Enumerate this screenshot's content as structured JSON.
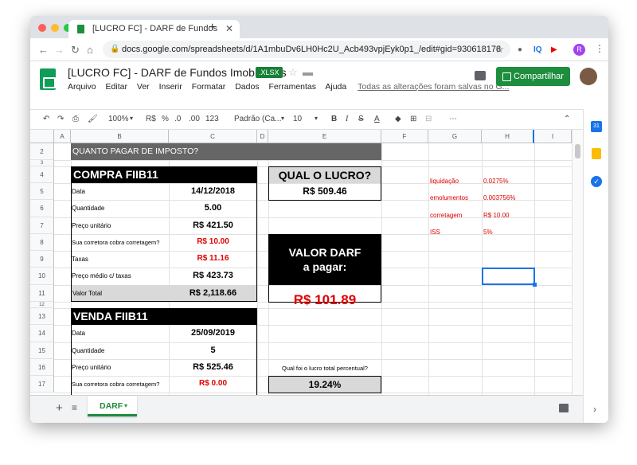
{
  "browser": {
    "tab_title": "[LUCRO FC] - DARF de Fundos",
    "url": "docs.google.com/spreadsheets/d/1A1mbuDv6LH0Hc2U_Acb493vpjEyk0p1_/edit#gid=930618178",
    "profile_initial": "R"
  },
  "doc": {
    "title": "[LUCRO FC] - DARF de Fundos Imobiliários",
    "badge": ".XLSX",
    "menus": [
      "Arquivo",
      "Editar",
      "Ver",
      "Inserir",
      "Formatar",
      "Dados",
      "Ferramentas",
      "Ajuda"
    ],
    "saved_text": "Todas as alterações foram salvas no G...",
    "share_label": "Compartilhar"
  },
  "toolbar": {
    "zoom": "100%",
    "currency": "R$",
    "percent": "%",
    "dec_less": ".0",
    "dec_more": ".00",
    "number_format": "123",
    "font": "Padrão (Ca...",
    "font_size": "10"
  },
  "columns": [
    "A",
    "B",
    "C",
    "D",
    "E",
    "F",
    "G",
    "H",
    "I"
  ],
  "rows": [
    "2",
    "3",
    "4",
    "5",
    "6",
    "7",
    "8",
    "9",
    "10",
    "11",
    "12",
    "13",
    "14",
    "15",
    "16",
    "17"
  ],
  "sheet": {
    "banner": "QUANTO PAGAR DE IMPOSTO?",
    "compra": {
      "header": "COMPRA FIIB11",
      "rows": [
        {
          "label": "Data",
          "value": "14/12/2018"
        },
        {
          "label": "Quantidade",
          "value": "5.00"
        },
        {
          "label": "Preço unitário",
          "value": "R$ 421.50"
        },
        {
          "label": "Sua corretora cobra corretagem?",
          "value": "R$ 10.00"
        },
        {
          "label": "Taxas",
          "value": "R$ 11.16"
        },
        {
          "label": "Preço médio c/ taxas",
          "value": "R$ 423.73"
        },
        {
          "label": "Valor Total",
          "value": "R$ 2,118.66"
        }
      ]
    },
    "venda": {
      "header": "VENDA FIIB11",
      "rows": [
        {
          "label": "Data",
          "value": "25/09/2019"
        },
        {
          "label": "Quantidade",
          "value": "5"
        },
        {
          "label": "Preço unitário",
          "value": "R$ 525.46"
        },
        {
          "label": "Sua corretora cobra corretagem?",
          "value": "R$ 0.00"
        }
      ]
    },
    "lucro": {
      "title": "QUAL O LUCRO?",
      "value": "R$ 509.46"
    },
    "darf": {
      "title_line1": "VALOR DARF",
      "title_line2": "a pagar:",
      "value": "R$ 101.89"
    },
    "percentual": {
      "question": "Qual foi o lucro total percentual?",
      "value": "19.24%"
    },
    "params": [
      {
        "label": "liquidação",
        "value": "0.0275%"
      },
      {
        "label": "emolumentos",
        "value": "0.003756%"
      },
      {
        "label": "corretagem",
        "value": "R$ 10.00"
      },
      {
        "label": "ISS",
        "value": "5%"
      }
    ]
  },
  "sheet_tab": "DARF",
  "colors": {
    "red": "#e00000",
    "black": "#000000",
    "banner": "#666666",
    "gray_cell": "#d9d9d9",
    "green": "#1e8e3e"
  }
}
